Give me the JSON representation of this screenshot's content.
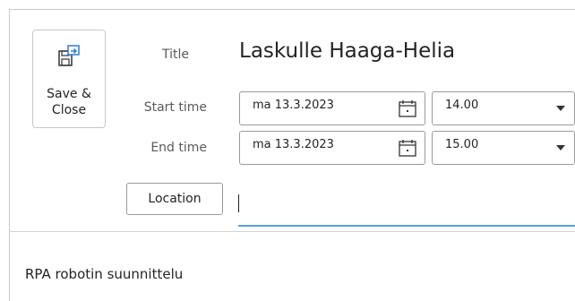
{
  "toolbar": {
    "save_close_label": "Save &\nClose",
    "save_close_icon": "save-close-icon"
  },
  "fields": {
    "title_label": "Title",
    "title_value": "Laskulle Haaga-Helia",
    "start_label": "Start time",
    "start_date": "ma 13.3.2023",
    "start_time": "14.00",
    "end_label": "End time",
    "end_date": "ma 13.3.2023",
    "end_time": "15.00",
    "location_button": "Location",
    "location_value": ""
  },
  "body": {
    "text": "RPA robotin suunnittelu"
  },
  "colors": {
    "accent_underline": "#5aa0d6"
  }
}
